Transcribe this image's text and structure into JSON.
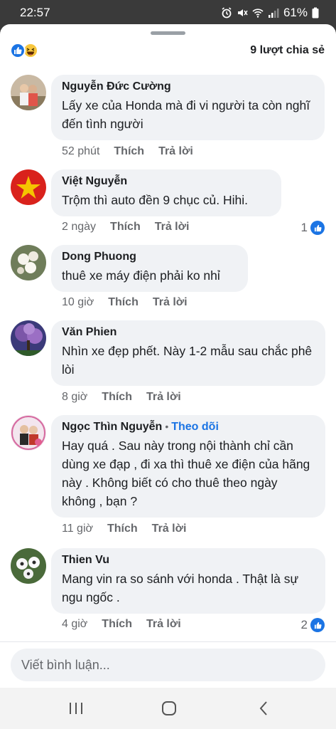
{
  "status_bar": {
    "time": "22:57",
    "battery": "61%",
    "icons": [
      "alarm-icon",
      "mute-icon",
      "wifi-icon",
      "signal-icon",
      "battery-icon"
    ]
  },
  "header": {
    "reactions": [
      "like-icon",
      "haha-icon"
    ],
    "shares": "9 lượt chia sẻ"
  },
  "comments": [
    {
      "author": "Nguyễn Đức Cường",
      "text": "Lấy xe của Honda mà đi vi người ta còn nghĩ đến tình người",
      "time": "52 phút",
      "like": "Thích",
      "reply": "Trả lời",
      "likes": ""
    },
    {
      "author": "Việt Nguyễn",
      "text": "Trộm thì auto đền 9 chục củ. Hihi.",
      "time": "2 ngày",
      "like": "Thích",
      "reply": "Trả lời",
      "likes": "1"
    },
    {
      "author": "Dong Phuong",
      "text": "thuê xe máy điện phải ko nhỉ",
      "time": "10 giờ",
      "like": "Thích",
      "reply": "Trả lời",
      "likes": ""
    },
    {
      "author": "Văn Phien",
      "text": "Nhìn xe đẹp phết. Này 1-2 mẫu sau chắc phê lòi",
      "time": "8 giờ",
      "like": "Thích",
      "reply": "Trả lời",
      "likes": ""
    },
    {
      "author": "Ngọc Thìn Nguyễn",
      "follow": "Theo dõi",
      "text": "Hay quá . Sau này trong nội thành chỉ cần dùng xe đạp , đi xa thì thuê xe điện của hãng này . Không biết có cho thuê theo ngày không , bạn ?",
      "time": "11 giờ",
      "like": "Thích",
      "reply": "Trả lời",
      "likes": ""
    },
    {
      "author": "Thien Vu",
      "text": "Mang vin ra so sánh với honda . Thật là sự ngu ngốc .",
      "time": "4 giờ",
      "like": "Thích",
      "reply": "Trả lời",
      "likes": "2"
    }
  ],
  "composer": {
    "placeholder": "Viết bình luận..."
  },
  "nav": [
    "recents-icon",
    "home-icon",
    "back-icon"
  ],
  "colors": {
    "accent": "#1b74e4",
    "bubble": "#f0f2f5",
    "muted": "#65676b"
  }
}
